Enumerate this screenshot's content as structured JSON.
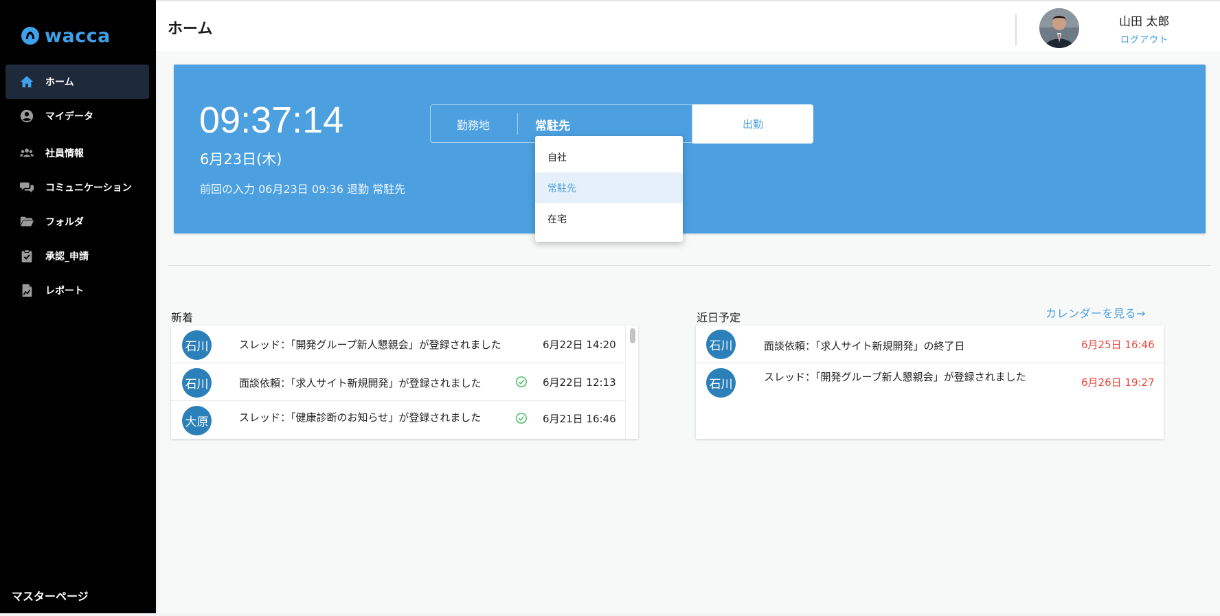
{
  "app": {
    "logo_text": "wacca"
  },
  "sidebar": {
    "items": [
      {
        "label": "ホーム",
        "icon": "home-icon",
        "active": true
      },
      {
        "label": "マイデータ",
        "icon": "user-circle-icon",
        "active": false
      },
      {
        "label": "社員情報",
        "icon": "users-icon",
        "active": false
      },
      {
        "label": "コミュニケーション",
        "icon": "chat-icon",
        "active": false
      },
      {
        "label": "フォルダ",
        "icon": "folder-icon",
        "active": false
      },
      {
        "label": "承認_申請",
        "icon": "clipboard-check-icon",
        "active": false
      },
      {
        "label": "レポート",
        "icon": "report-icon",
        "active": false
      }
    ],
    "footer_label": "マスターページ"
  },
  "header": {
    "title": "ホーム",
    "user_name": "山田 太郎",
    "logout_label": "ログアウト"
  },
  "attendance": {
    "time": "09:37:14",
    "date": "6月23日(木)",
    "previous_entry": "前回の入力 06月23日 09:36 退勤 常駐先",
    "location_label": "勤務地",
    "location_value": "常駐先",
    "clock_in_label": "出勤",
    "location_options": [
      {
        "label": "自社",
        "selected": false
      },
      {
        "label": "常駐先",
        "selected": true
      },
      {
        "label": "在宅",
        "selected": false
      }
    ]
  },
  "news": {
    "title": "新着",
    "items": [
      {
        "avatar": "石川",
        "text": "スレッド：「開発グループ新人懇親会」が登録されました",
        "time": "6月22日 14:20",
        "checked": false
      },
      {
        "avatar": "石川",
        "text": "面談依頼：「求人サイト新規開発」が登録されました",
        "time": "6月22日 12:13",
        "checked": true
      },
      {
        "avatar": "大原",
        "text": "スレッド：「健康診断のお知らせ」が登録されました",
        "time": "6月21日 16:46",
        "checked": true
      }
    ]
  },
  "schedule": {
    "title": "近日予定",
    "calendar_link": "カレンダーを見る→",
    "items": [
      {
        "avatar": "石川",
        "text": "面談依頼：「求人サイト新規開発」の終了日",
        "time": "6月25日 16:46"
      },
      {
        "avatar": "石川",
        "text": "スレッド：「開発グループ新人懇親会」が登録されました",
        "time": "6月26日 19:27"
      }
    ]
  },
  "colors": {
    "accent": "#4ca0e0",
    "sidebar_bg": "#010101",
    "sidebar_active": "#1e2a3a",
    "avatar_bg": "#2b80b9",
    "deadline_red": "#e8463b",
    "check_green": "#3cb95a"
  }
}
